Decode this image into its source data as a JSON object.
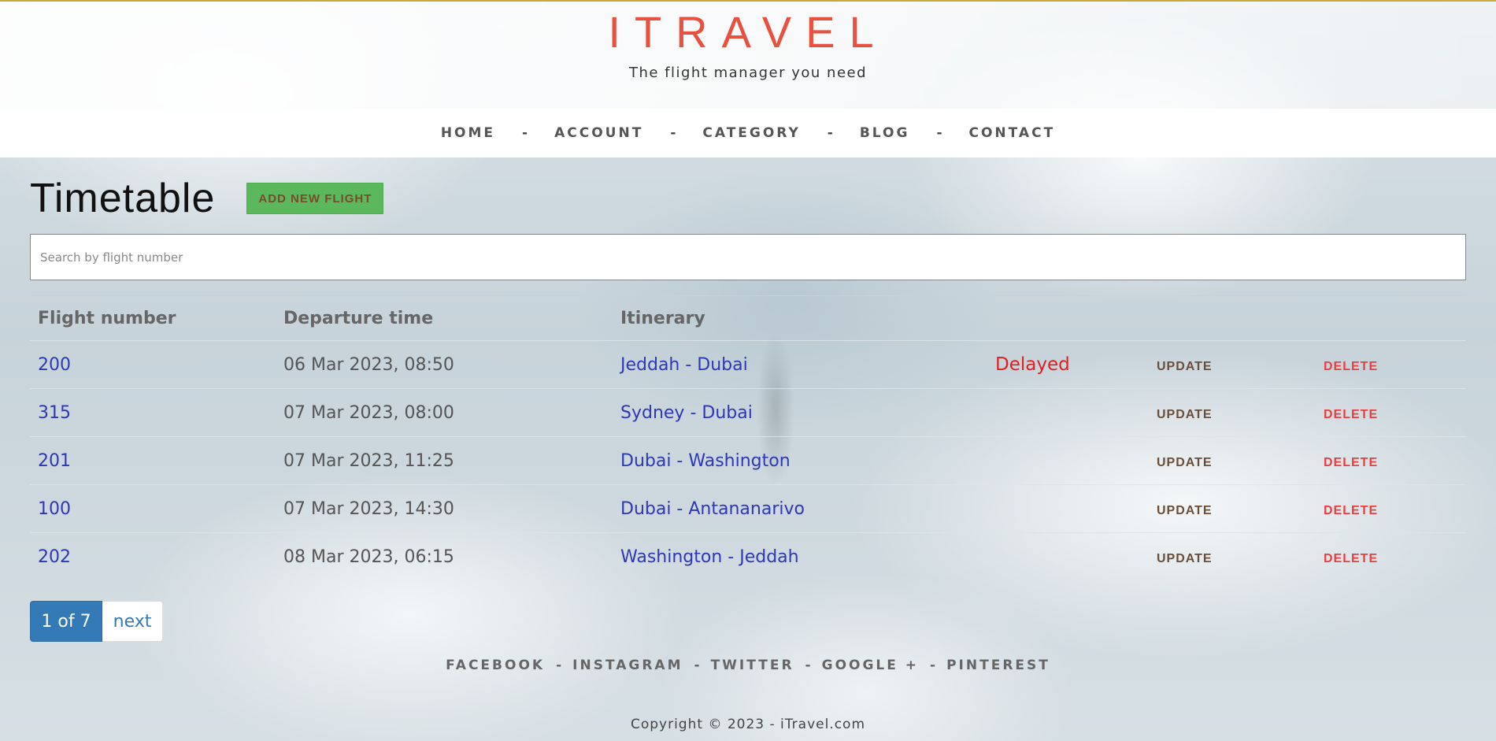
{
  "brand": {
    "name": "ITRAVEL",
    "tagline": "The flight manager you need"
  },
  "nav": {
    "items": [
      {
        "label": "HOME"
      },
      {
        "label": "ACCOUNT"
      },
      {
        "label": "CATEGORY"
      },
      {
        "label": "BLOG"
      },
      {
        "label": "CONTACT"
      }
    ],
    "separator": "-"
  },
  "page": {
    "title": "Timetable",
    "add_button_label": "ADD NEW FLIGHT"
  },
  "search": {
    "placeholder": "Search by flight number",
    "value": ""
  },
  "table": {
    "headers": {
      "flight_number": "Flight number",
      "departure_time": "Departure time",
      "itinerary": "Itinerary"
    },
    "rows": [
      {
        "flight_number": "200",
        "departure": "06 Mar 2023, 08:50",
        "itinerary": "Jeddah - Dubai",
        "status": "Delayed",
        "update": "UPDATE",
        "delete": "DELETE"
      },
      {
        "flight_number": "315",
        "departure": "07 Mar 2023, 08:00",
        "itinerary": "Sydney - Dubai",
        "status": "",
        "update": "UPDATE",
        "delete": "DELETE"
      },
      {
        "flight_number": "201",
        "departure": "07 Mar 2023, 11:25",
        "itinerary": "Dubai - Washington",
        "status": "",
        "update": "UPDATE",
        "delete": "DELETE"
      },
      {
        "flight_number": "100",
        "departure": "07 Mar 2023, 14:30",
        "itinerary": "Dubai - Antananarivo",
        "status": "",
        "update": "UPDATE",
        "delete": "DELETE"
      },
      {
        "flight_number": "202",
        "departure": "08 Mar 2023, 06:15",
        "itinerary": "Washington - Jeddah",
        "status": "",
        "update": "UPDATE",
        "delete": "DELETE"
      }
    ]
  },
  "pagination": {
    "current": "1 of 7",
    "next_label": "next"
  },
  "footer": {
    "social": [
      {
        "label": "FACEBOOK"
      },
      {
        "label": "INSTAGRAM"
      },
      {
        "label": "TWITTER"
      },
      {
        "label": "GOOGLE +"
      },
      {
        "label": "PINTEREST"
      }
    ],
    "separator": "-",
    "copyright": "Copyright © 2023 - iTravel.com"
  },
  "colors": {
    "brand": "#e8513f",
    "link": "#2e37b7",
    "status_delayed": "#e02020",
    "add_button_bg": "#5cb85c",
    "pager_active": "#337ab7",
    "delete": "#e84040"
  }
}
